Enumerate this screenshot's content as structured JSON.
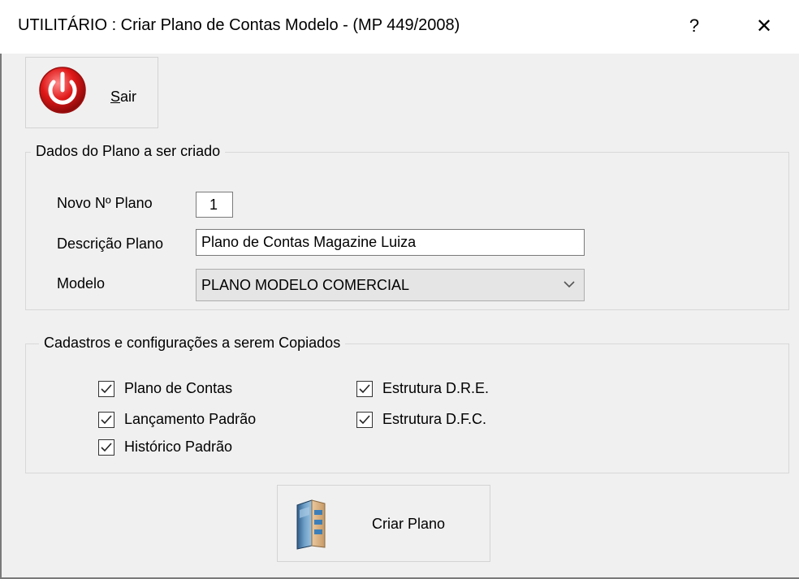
{
  "window": {
    "title": "UTILITÁRIO : Criar Plano de Contas Modelo - (MP 449/2008)",
    "help_label": "?",
    "close_label": "✕"
  },
  "toolbar": {
    "sair_mnemonic": "S",
    "sair_rest": "air"
  },
  "dados": {
    "group_title": "Dados do Plano a ser criado",
    "novo_label": "Novo Nº  Plano",
    "novo_value": "1",
    "descricao_label": "Descrição Plano",
    "descricao_value": "Plano de Contas Magazine Luiza",
    "modelo_label": "Modelo",
    "modelo_value": "PLANO MODELO COMERCIAL"
  },
  "cadastros": {
    "group_title": "Cadastros e configurações a serem Copiados",
    "items": [
      {
        "label": "Plano de Contas",
        "checked": true
      },
      {
        "label": "Lançamento Padrão",
        "checked": true
      },
      {
        "label": "Histórico Padrão",
        "checked": true
      },
      {
        "label": "Estrutura D.R.E.",
        "checked": true
      },
      {
        "label": "Estrutura D.F.C.",
        "checked": true
      }
    ]
  },
  "actions": {
    "criar_label": "Criar Plano"
  },
  "colors": {
    "accent_red": "#d81b1b",
    "window_bg": "#f0f0f0"
  }
}
